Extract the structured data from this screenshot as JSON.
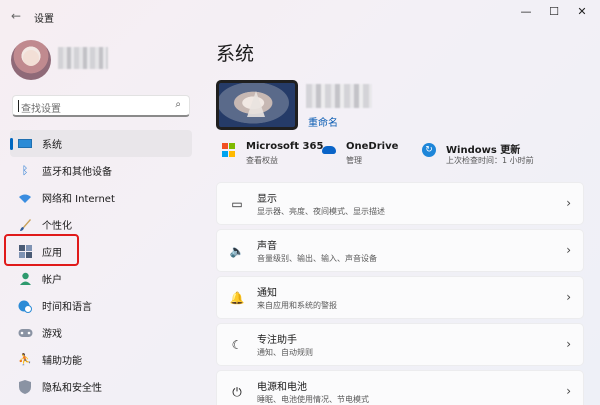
{
  "window": {
    "title": "设置",
    "back_glyph": "←",
    "minimize_glyph": "—",
    "maximize_glyph": "☐",
    "close_glyph": "✕"
  },
  "search": {
    "placeholder": "查找设置",
    "icon": "search-icon"
  },
  "sidebar": {
    "items": [
      {
        "label": "系统",
        "icon": "monitor-icon",
        "selected": true
      },
      {
        "label": "蓝牙和其他设备",
        "icon": "bluetooth-icon"
      },
      {
        "label": "网络和 Internet",
        "icon": "wifi-icon"
      },
      {
        "label": "个性化",
        "icon": "brush-icon"
      },
      {
        "label": "应用",
        "icon": "apps-icon"
      },
      {
        "label": "帐户",
        "icon": "account-icon"
      },
      {
        "label": "时间和语言",
        "icon": "globe-clock-icon"
      },
      {
        "label": "游戏",
        "icon": "gamepad-icon"
      },
      {
        "label": "辅助功能",
        "icon": "accessibility-icon"
      },
      {
        "label": "隐私和安全性",
        "icon": "shield-icon"
      }
    ]
  },
  "main": {
    "title": "系统",
    "rename_label": "重命名",
    "info": [
      {
        "title": "Microsoft 365",
        "sub": "查看权益",
        "icon": "microsoft-logo-icon"
      },
      {
        "title": "OneDrive",
        "sub": "管理",
        "icon": "onedrive-cloud-icon"
      },
      {
        "title": "Windows 更新",
        "sub": "上次检查时间：1 小时前",
        "icon": "windows-update-icon"
      }
    ],
    "cards": [
      {
        "title": "显示",
        "sub": "显示器、亮度、夜间模式、显示描述",
        "icon": "display-icon",
        "glyph": "▭"
      },
      {
        "title": "声音",
        "sub": "音量级别、输出、输入、声音设备",
        "icon": "speaker-icon",
        "glyph": "🔈"
      },
      {
        "title": "通知",
        "sub": "来自应用和系统的警报",
        "icon": "bell-icon",
        "glyph": "🔔"
      },
      {
        "title": "专注助手",
        "sub": "通知、自动规则",
        "icon": "moon-icon",
        "glyph": "☾"
      },
      {
        "title": "电源和电池",
        "sub": "睡眠、电池使用情况、节电模式",
        "icon": "power-icon",
        "glyph": "⏻"
      }
    ],
    "chevron": "›"
  },
  "colors": {
    "accent": "#0067c0",
    "highlight": "#e01a1a",
    "link": "#0a5cb3"
  }
}
